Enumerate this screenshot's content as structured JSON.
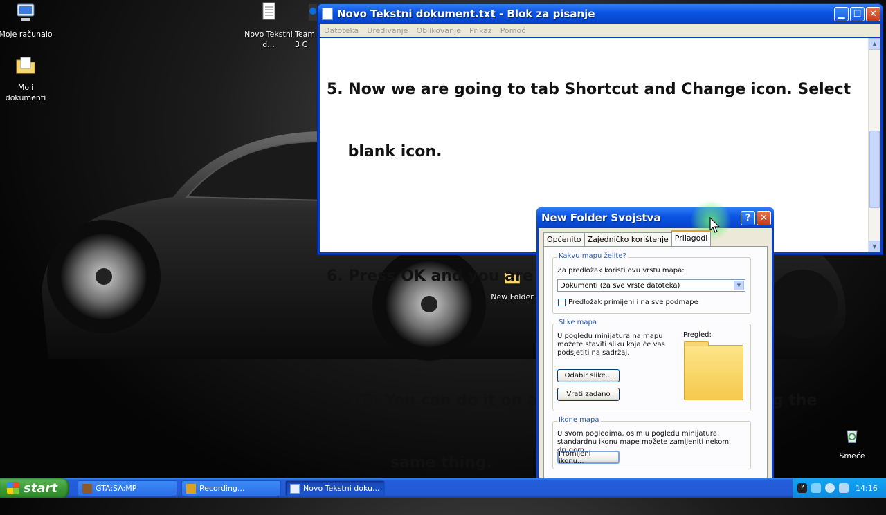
{
  "desktop": {
    "icons": [
      {
        "label": "Moje računalo"
      },
      {
        "label": "Moji dokumenti"
      },
      {
        "label": "Novo Tekstni d..."
      },
      {
        "label": "Team 3 C"
      },
      {
        "label": "New Folder"
      },
      {
        "label": "Smeće"
      }
    ]
  },
  "notepad": {
    "title": "Novo Tekstni dokument.txt - Blok za pisanje",
    "menu": [
      "Datoteka",
      "Uređivanje",
      "Oblikovanje",
      "Prikaz",
      "Pomoć"
    ],
    "lines": [
      "5. Now we are going to tab Shortcut and Change icon. Select",
      "    blank icon.",
      "",
      "6. Press OK and you are done.",
      "",
      "NOTE: You can do it on any folder and shortcut doing the",
      "            same thing."
    ]
  },
  "dialog": {
    "title": "New Folder Svojstva",
    "tabs": [
      "Općenito",
      "Zajedničko korištenje",
      "Prilagodi"
    ],
    "active_tab": "Prilagodi",
    "group1": {
      "title": "Kakvu mapu želite?",
      "template_label": "Za predložak koristi ovu vrstu mapa:",
      "template_value": "Dokumenti (za sve vrste datoteka)",
      "apply_all_label": "Predložak primijeni i na sve podmape",
      "apply_all_checked": false
    },
    "group2": {
      "title": "Slike mapa",
      "desc": "U pogledu minijatura na mapu možete staviti sliku koja će vas podsjetiti na sadržaj.",
      "preview_label": "Pregled:",
      "choose_button": "Odabir slike...",
      "restore_button": "Vrati zadano"
    },
    "group3": {
      "title": "Ikone mapa",
      "desc": "U svom pogledima, osim u pogledu minijatura, standardnu ikonu mape možete zamijeniti nekom drugom.",
      "change_button": "Promijeni ikonu..."
    }
  },
  "taskbar": {
    "start_label": "start",
    "buttons": [
      {
        "label": "GTA:SA:MP"
      },
      {
        "label": "Recording..."
      },
      {
        "label": "Novo Tekstni doku..."
      }
    ],
    "active_button": "Novo Tekstni doku...",
    "clock": "14:16"
  }
}
